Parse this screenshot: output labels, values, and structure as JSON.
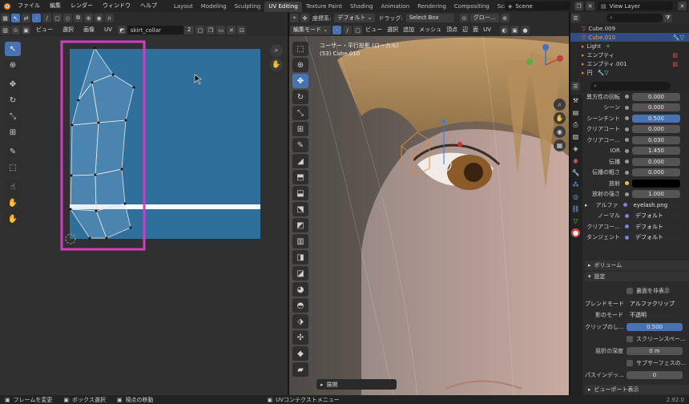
{
  "topbar": {
    "menus": [
      "ファイル",
      "編集",
      "レンダー",
      "ウィンドウ",
      "ヘルプ"
    ],
    "workspaces": [
      "Layout",
      "Modeling",
      "Sculpting",
      "UV Editing",
      "Texture Paint",
      "Shading",
      "Animation",
      "Rendering",
      "Compositing",
      "Scripting"
    ],
    "active_workspace": "UV Editing",
    "scene": "Scene",
    "view_layer": "View Layer"
  },
  "uv_editor": {
    "menus": [
      "ビュー",
      "選択",
      "画像",
      "UV"
    ],
    "image_name": "skirt_collar",
    "users": "2"
  },
  "viewport": {
    "mode": "編集モード",
    "orientation_label": "座標系:",
    "orientation": "デフォルト",
    "drag_label": "ドラッグ:",
    "drag": "Select Box",
    "pivot": "グロー...",
    "menus": [
      "ビュー",
      "選択",
      "追加",
      "メッシュ",
      "頂点",
      "辺",
      "面",
      "UV"
    ],
    "overlay_title": "ユーザー・平行投影 (ローカル)",
    "overlay_sub": "(53) Cube.010",
    "last_op": "展開"
  },
  "outliner": {
    "items": [
      {
        "label": "Cube.009"
      },
      {
        "label": "Cube.010"
      },
      {
        "label": "Light"
      },
      {
        "label": "エンプティ"
      },
      {
        "label": "エンプティ.001"
      },
      {
        "label": "円"
      }
    ],
    "search_placeholder": ""
  },
  "properties": {
    "rows": [
      {
        "label": "異方性の回転",
        "value": "0.000",
        "style": ""
      },
      {
        "label": "シーン",
        "value": "0.000",
        "style": ""
      },
      {
        "label": "シーンチント",
        "value": "0.500",
        "style": "blue"
      },
      {
        "label": "クリアコート",
        "value": "0.000",
        "style": ""
      },
      {
        "label": "クリアコー...",
        "value": "0.030",
        "style": ""
      },
      {
        "label": "IOR",
        "value": "1.450",
        "style": ""
      },
      {
        "label": "伝播",
        "value": "0.000",
        "style": ""
      },
      {
        "label": "伝播の粗さ",
        "value": "0.000",
        "style": ""
      },
      {
        "label": "放射",
        "value": "",
        "style": "black"
      },
      {
        "label": "放射の強さ",
        "value": "1.000",
        "style": ""
      },
      {
        "label": "アルファ",
        "value": "eyelash.png",
        "style": "dark"
      },
      {
        "label": "ノーマル",
        "value": "デフォルト",
        "style": "dark"
      },
      {
        "label": "クリアコー...",
        "value": "デフォルト",
        "style": "dark"
      },
      {
        "label": "タンジェント",
        "value": "デフォルト",
        "style": "dark"
      }
    ],
    "volume_label": "ボリューム",
    "settings_label": "設定",
    "backface_label": "裏面を非表示",
    "blend_mode_label": "ブレンドモード",
    "blend_mode": "アルファクリップ",
    "shadow_mode_label": "影のモード",
    "shadow_mode": "不透明",
    "clip_label": "クリップのし...",
    "clip_value": "0.500",
    "screen_space_label": "スクリーンスペー...",
    "refraction_depth_label": "屈折の深度",
    "refraction_depth": "0 m",
    "subsurface_label": "サブサーフェスの...",
    "pass_index_label": "パスインデッ...",
    "pass_index": "0",
    "viewport_display_label": "ビューポート表示"
  },
  "statusbar": {
    "items": [
      "フレームを変更",
      "ボックス選択",
      "視点の移動"
    ],
    "center": "UVコンテクストメニュー",
    "version": "2.92.0"
  },
  "colors": {
    "accent": "#4772b3",
    "uv_image_bg": "#2f6f9c",
    "highlight_box": "#d63bc7",
    "object_active": "#f0a050"
  }
}
